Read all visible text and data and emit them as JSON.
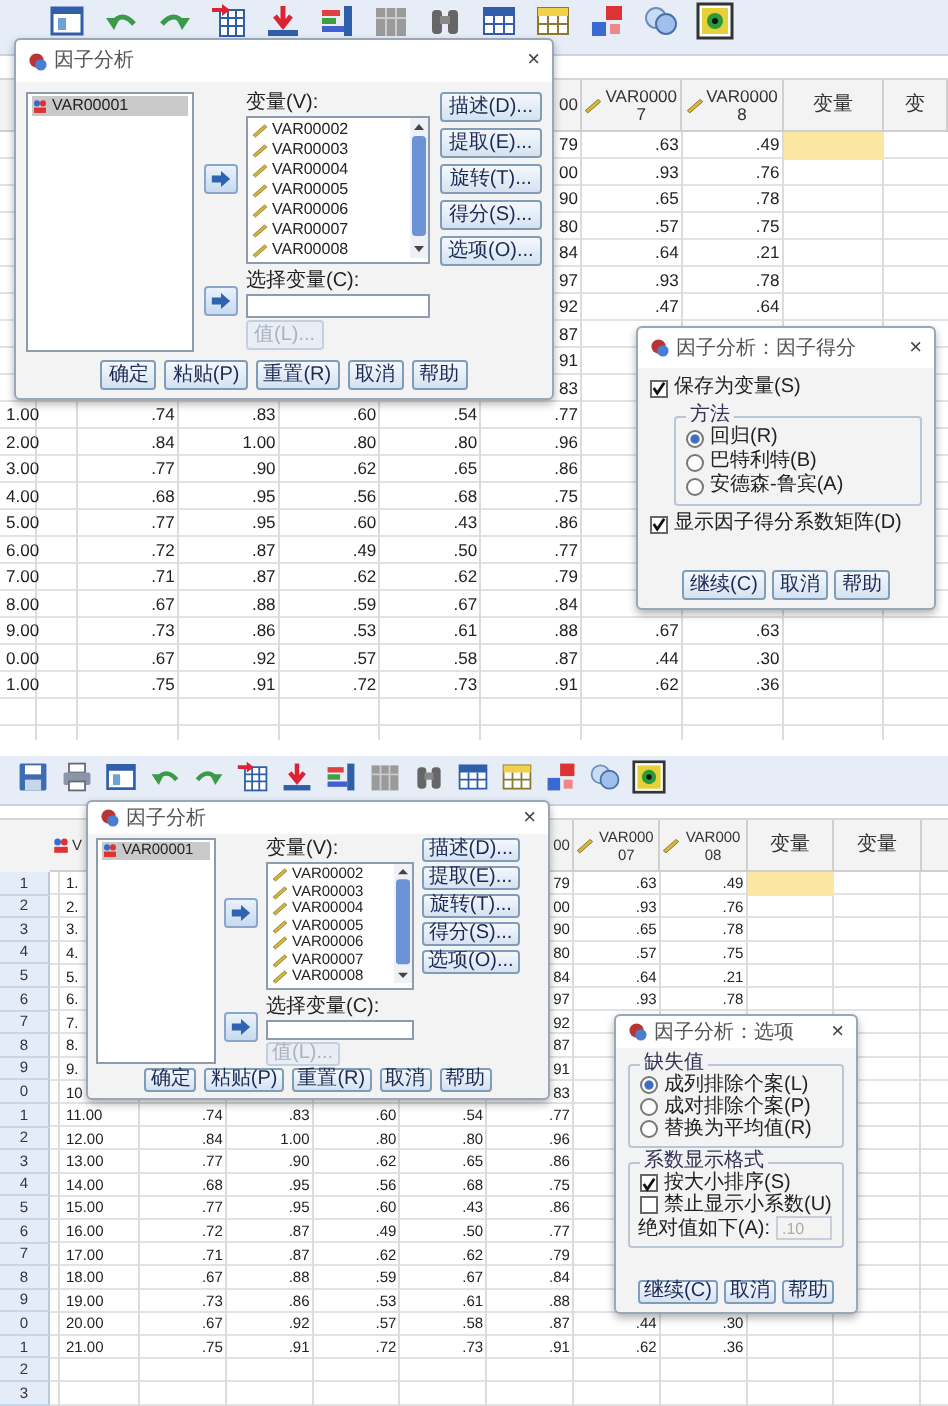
{
  "screenshots": [
    {
      "data_view": {
        "columns": [
          {},
          {},
          {},
          {},
          {},
          {
            "header": "00"
          },
          {
            "header": "VAR00007",
            "kind": "scale"
          },
          {
            "header": "VAR00008",
            "kind": "scale"
          },
          {
            "header": "变量"
          },
          {
            "header": "变"
          }
        ],
        "rows": [
          {
            "cells": [
              null,
              null,
              null,
              null,
              null,
              "79",
              ".63",
              ".49",
              {
                "selected": true
              },
              null
            ]
          },
          {
            "cells": [
              null,
              null,
              null,
              null,
              null,
              "00",
              ".93",
              ".76"
            ]
          },
          {
            "cells": [
              null,
              null,
              null,
              null,
              null,
              "90",
              ".65",
              ".78"
            ]
          },
          {
            "cells": [
              null,
              null,
              null,
              null,
              null,
              "80",
              ".57",
              ".75"
            ]
          },
          {
            "cells": [
              null,
              null,
              null,
              null,
              null,
              "84",
              ".64",
              ".21"
            ]
          },
          {
            "cells": [
              null,
              null,
              null,
              null,
              null,
              "97",
              ".93",
              ".78"
            ]
          },
          {
            "cells": [
              null,
              null,
              null,
              null,
              null,
              "92",
              ".47",
              ".64"
            ]
          },
          {
            "cells": [
              null,
              null,
              null,
              null,
              null,
              "87"
            ]
          },
          {
            "cells": [
              null,
              null,
              null,
              null,
              null,
              "91"
            ]
          },
          {
            "cells": [
              null,
              null,
              null,
              null,
              null,
              "83"
            ]
          },
          {
            "cells": [
              "1.00",
              ".74",
              ".83",
              ".60",
              ".54",
              ".77"
            ]
          },
          {
            "cells": [
              "2.00",
              ".84",
              "1.00",
              ".80",
              ".80",
              ".96"
            ]
          },
          {
            "cells": [
              "3.00",
              ".77",
              ".90",
              ".62",
              ".65",
              ".86"
            ]
          },
          {
            "cells": [
              "4.00",
              ".68",
              ".95",
              ".56",
              ".68",
              ".75"
            ]
          },
          {
            "cells": [
              "5.00",
              ".77",
              ".95",
              ".60",
              ".43",
              ".86"
            ]
          },
          {
            "cells": [
              "6.00",
              ".72",
              ".87",
              ".49",
              ".50",
              ".77"
            ]
          },
          {
            "cells": [
              "7.00",
              ".71",
              ".87",
              ".62",
              ".62",
              ".79"
            ]
          },
          {
            "cells": [
              "8.00",
              ".67",
              ".88",
              ".59",
              ".67",
              ".84"
            ]
          },
          {
            "cells": [
              "9.00",
              ".73",
              ".86",
              ".53",
              ".61",
              ".88",
              ".67",
              ".63"
            ]
          },
          {
            "cells": [
              "0.00",
              ".67",
              ".92",
              ".57",
              ".58",
              ".87",
              ".44",
              ".30"
            ]
          },
          {
            "cells": [
              "1.00",
              ".75",
              ".91",
              ".72",
              ".73",
              ".91",
              ".62",
              ".36"
            ]
          }
        ]
      },
      "factor_dialog": {
        "title": "因子分析",
        "close": "×",
        "source_list": [
          {
            "label": "VAR00001",
            "selected": true
          }
        ],
        "variables_label": "变量(V):",
        "variables": [
          "VAR00002",
          "VAR00003",
          "VAR00004",
          "VAR00005",
          "VAR00006",
          "VAR00007",
          "VAR00008"
        ],
        "selection_label": "选择变量(C):",
        "value_button": {
          "label": "值(L)...",
          "disabled": true
        },
        "side_buttons": [
          "描述(D)...",
          "提取(E)...",
          "旋转(T)...",
          "得分(S)...",
          "选项(O)..."
        ],
        "buttons": [
          "确定",
          "粘贴(P)",
          "重置(R)",
          "取消",
          "帮助"
        ]
      },
      "sub_dialog": {
        "title": "因子分析：因子得分",
        "close": "×",
        "items": [
          {
            "kind": "checkbox",
            "label": "保存为变量(S)",
            "checked": true
          },
          {
            "kind": "group",
            "legend": "方法",
            "items": [
              {
                "kind": "radio",
                "label": "回归(R)",
                "selected": true
              },
              {
                "kind": "radio",
                "label": "巴特利特(B)",
                "selected": false
              },
              {
                "kind": "radio",
                "label": "安德森-鲁宾(A)",
                "selected": false
              }
            ]
          },
          {
            "kind": "checkbox",
            "label": "显示因子得分系数矩阵(D)",
            "checked": true
          }
        ],
        "buttons": [
          "继续(C)",
          "取消",
          "帮助"
        ]
      }
    },
    {
      "data_view": {
        "columns": [
          {
            "header": "V",
            "kind": "nominal"
          },
          {},
          {},
          {},
          {},
          {
            "header": "00"
          },
          {
            "header": "VAR00007",
            "kind": "scale"
          },
          {
            "header": "VAR00008",
            "kind": "scale"
          },
          {
            "header": "变量"
          },
          {
            "header": "变量"
          },
          {}
        ],
        "rows": [
          {
            "header": "1",
            "cells": [
              "1.",
              null,
              null,
              null,
              null,
              "79",
              ".63",
              ".49",
              {
                "selected": true
              }
            ]
          },
          {
            "header": "2",
            "cells": [
              "2.",
              null,
              null,
              null,
              null,
              "00",
              ".93",
              ".76"
            ]
          },
          {
            "header": "3",
            "cells": [
              "3.",
              null,
              null,
              null,
              null,
              "90",
              ".65",
              ".78"
            ]
          },
          {
            "header": "4",
            "cells": [
              "4.",
              null,
              null,
              null,
              null,
              "80",
              ".57",
              ".75"
            ]
          },
          {
            "header": "5",
            "cells": [
              "5.",
              null,
              null,
              null,
              null,
              "84",
              ".64",
              ".21"
            ]
          },
          {
            "header": "6",
            "cells": [
              "6.",
              null,
              null,
              null,
              null,
              "97",
              ".93",
              ".78"
            ]
          },
          {
            "header": "7",
            "cells": [
              "7.",
              null,
              null,
              null,
              null,
              "92"
            ]
          },
          {
            "header": "8",
            "cells": [
              "8.",
              null,
              null,
              null,
              null,
              "87"
            ]
          },
          {
            "header": "9",
            "cells": [
              "9.",
              null,
              null,
              null,
              null,
              "91"
            ]
          },
          {
            "header": "0",
            "cells": [
              "10",
              null,
              null,
              null,
              null,
              "83"
            ]
          },
          {
            "header": "1",
            "cells": [
              "11.00",
              ".74",
              ".83",
              ".60",
              ".54",
              ".77"
            ]
          },
          {
            "header": "2",
            "cells": [
              "12.00",
              ".84",
              "1.00",
              ".80",
              ".80",
              ".96"
            ]
          },
          {
            "header": "3",
            "cells": [
              "13.00",
              ".77",
              ".90",
              ".62",
              ".65",
              ".86"
            ]
          },
          {
            "header": "4",
            "cells": [
              "14.00",
              ".68",
              ".95",
              ".56",
              ".68",
              ".75"
            ]
          },
          {
            "header": "5",
            "cells": [
              "15.00",
              ".77",
              ".95",
              ".60",
              ".43",
              ".86"
            ]
          },
          {
            "header": "6",
            "cells": [
              "16.00",
              ".72",
              ".87",
              ".49",
              ".50",
              ".77"
            ]
          },
          {
            "header": "7",
            "cells": [
              "17.00",
              ".71",
              ".87",
              ".62",
              ".62",
              ".79"
            ]
          },
          {
            "header": "8",
            "cells": [
              "18.00",
              ".67",
              ".88",
              ".59",
              ".67",
              ".84"
            ]
          },
          {
            "header": "9",
            "cells": [
              "19.00",
              ".73",
              ".86",
              ".53",
              ".61",
              ".88"
            ]
          },
          {
            "header": "0",
            "cells": [
              "20.00",
              ".67",
              ".92",
              ".57",
              ".58",
              ".87",
              ".44",
              ".30"
            ]
          },
          {
            "header": "1",
            "cells": [
              "21.00",
              ".75",
              ".91",
              ".72",
              ".73",
              ".91",
              ".62",
              ".36"
            ]
          },
          {
            "header": "2"
          },
          {
            "header": "3"
          }
        ]
      },
      "factor_dialog": {
        "title": "因子分析",
        "close": "×",
        "source_list": [
          {
            "label": "VAR00001",
            "selected": true
          }
        ],
        "variables_label": "变量(V):",
        "variables": [
          "VAR00002",
          "VAR00003",
          "VAR00004",
          "VAR00005",
          "VAR00006",
          "VAR00007",
          "VAR00008"
        ],
        "selection_label": "选择变量(C):",
        "value_button": {
          "label": "值(L)...",
          "disabled": true
        },
        "side_buttons": [
          "描述(D)...",
          "提取(E)...",
          "旋转(T)...",
          "得分(S)...",
          "选项(O)..."
        ],
        "buttons": [
          "确定",
          "粘贴(P)",
          "重置(R)",
          "取消",
          "帮助"
        ]
      },
      "sub_dialog": {
        "title": "因子分析：选项",
        "close": "×",
        "items": [
          {
            "kind": "group",
            "legend": "缺失值",
            "items": [
              {
                "kind": "radio",
                "label": "成列排除个案(L)",
                "selected": true
              },
              {
                "kind": "radio",
                "label": "成对排除个案(P)",
                "selected": false
              },
              {
                "kind": "radio",
                "label": "替换为平均值(R)",
                "selected": false
              }
            ]
          },
          {
            "kind": "group",
            "legend": "系数显示格式",
            "items": [
              {
                "kind": "checkbox",
                "label": "按大小排序(S)",
                "checked": true
              },
              {
                "kind": "checkbox",
                "label": "禁止显示小系数(U)",
                "checked": false
              },
              {
                "kind": "field",
                "label": "绝对值如下(A):",
                "value": ".10",
                "disabled": true
              }
            ]
          }
        ],
        "buttons": [
          "继续(C)",
          "取消",
          "帮助"
        ]
      }
    }
  ]
}
